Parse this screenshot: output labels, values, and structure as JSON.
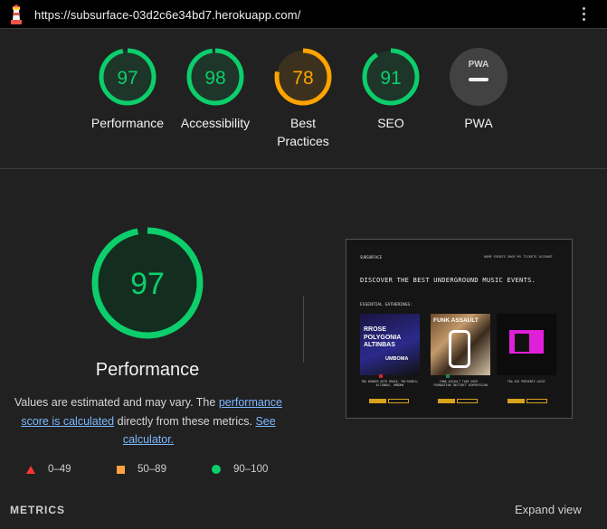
{
  "browser": {
    "url": "https://subsurface-03d2c6e34bd7.herokuapp.com/"
  },
  "colors": {
    "pass": "#0cce6b",
    "average": "#ffa400",
    "fail": "#ff4e42",
    "neutral": "#5c5c5c"
  },
  "categories": [
    {
      "score": "97",
      "label": "Performance",
      "status": "pass",
      "fraction": 0.97
    },
    {
      "score": "98",
      "label": "Accessibility",
      "status": "pass",
      "fraction": 0.98
    },
    {
      "score": "78",
      "label": "Best Practices",
      "status": "average",
      "fraction": 0.78
    },
    {
      "score": "91",
      "label": "SEO",
      "status": "pass",
      "fraction": 0.91
    },
    {
      "score": "",
      "label": "PWA",
      "status": "neutral",
      "badge": "PWA"
    }
  ],
  "performance": {
    "score": "97",
    "fraction": 0.97,
    "title": "Performance",
    "desc_1": "Values are estimated and may vary. The ",
    "link_1": "performance score is calculated",
    "desc_2": " directly from these metrics. ",
    "link_2": "See calculator."
  },
  "legend": [
    {
      "range": "0–49",
      "icon": "triangle-icon"
    },
    {
      "range": "50–89",
      "icon": "square-icon"
    },
    {
      "range": "90–100",
      "icon": "circle-icon"
    }
  ],
  "metrics": {
    "heading": "METRICS",
    "expand": "Expand view"
  },
  "screenshot": {
    "logo": "SUBSURFACE",
    "menu": "HOME  EVENTS  SHOP  MY TICKETS  ACCOUNT",
    "hero": "DISCOVER THE BEST UNDERGROUND MUSIC EVENTS.",
    "subheading": "ESSENTIAL GATHERINGS:",
    "cards": [
      {
        "title": "RROSE POLYGONIA ALTINBAS",
        "sub": "UMBOMA",
        "caption": "TBA BUNKER WITH RROSE, POLYGONIA, ALTINBAS, UMBOMA"
      },
      {
        "title": "FUNK ASSAULT",
        "caption": "FUNK ASSAULT TAKE OVER - FOUNDATION INSTINCT VOXPRESSION"
      },
      {
        "title": "",
        "caption": "TBA SOS PRESENTS LOGIC"
      }
    ]
  }
}
